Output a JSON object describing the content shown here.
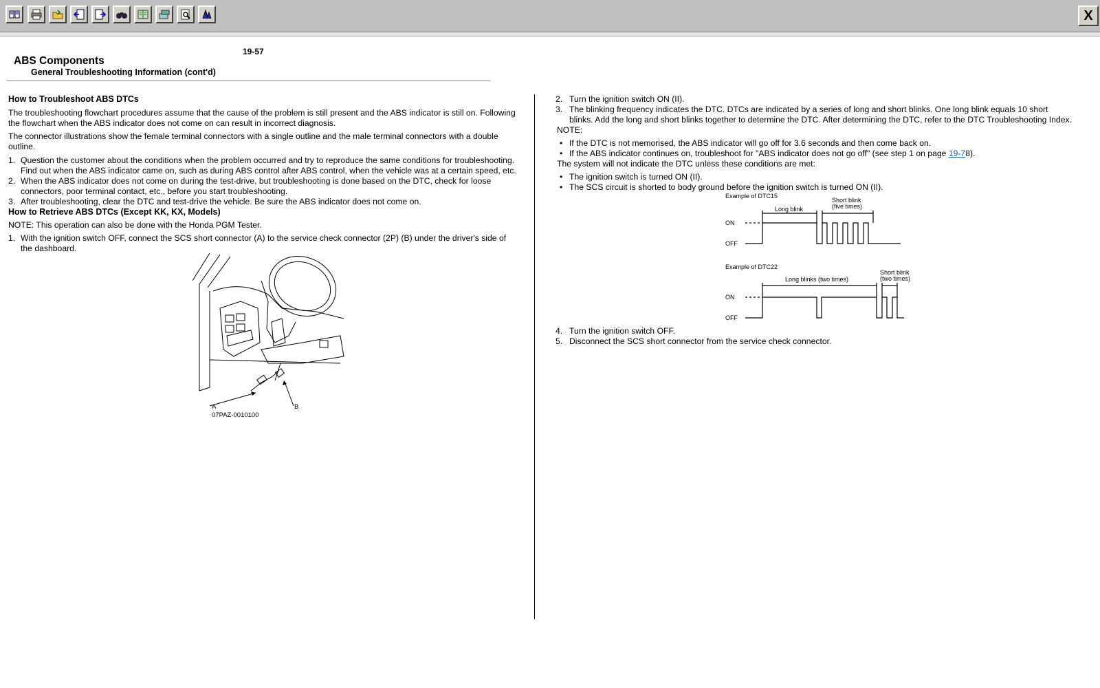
{
  "toolbar": {
    "buttons": [
      {
        "name": "contents-icon"
      },
      {
        "name": "print-icon"
      },
      {
        "name": "open-folder-icon"
      },
      {
        "name": "previous-page-icon"
      },
      {
        "name": "next-page-icon"
      },
      {
        "name": "find-icon"
      },
      {
        "name": "book-icon"
      },
      {
        "name": "sync-icon"
      },
      {
        "name": "preview-icon"
      },
      {
        "name": "bookmark-icon"
      }
    ],
    "close_label": "X"
  },
  "page": {
    "number": "19-57",
    "title": "ABS Components",
    "subtitle": "General Troubleshooting Information (cont'd)"
  },
  "left": {
    "h1": "How to Troubleshoot ABS DTCs",
    "p1_l1": "The troubleshooting flowchart procedures assume that the cause of the problem is still present and the ABS indicator is still on. Following",
    "p1_l2": "the flowchart when the ABS indicator does not come on can result in incorrect diagnosis.",
    "p2_l1": "The connector illustrations show the female terminal connectors with a single outline and the male terminal connectors with a double",
    "p2_l2": "outline.",
    "n1": "1.",
    "s1_l1": "Question the customer about the conditions when the problem occurred and try to reproduce the same conditions for troubleshooting.",
    "s1_l2": "Find out when the ABS indicator came on, such as during ABS control after ABS control, when the vehicle was at a certain speed, etc.",
    "n2": "2.",
    "s2_l1": "When the ABS indicator does not come on during the test-drive, but troubleshooting is done based on the DTC, check for loose",
    "s2_l2": "connectors, poor terminal contact, etc., before you start troubleshooting.",
    "n3": "3.",
    "s3_l1": "After troubleshooting, clear the DTC and test-drive the vehicle. Be sure the ABS indicator does not come on.",
    "h2": "How to Retrieve ABS DTCs (Except KK, KX, Models)",
    "note": "NOTE: This operation can also be done with the Honda PGM Tester.",
    "r1": "1.",
    "r1_l1": "With the ignition switch OFF, connect the SCS short connector (A) to the service check connector (2P) (B) under the driver's side of",
    "r1_l2": "the dashboard.",
    "fig_a": "A",
    "fig_b": "B",
    "fig_code": "07PAZ-0010100"
  },
  "right": {
    "n2": "2.",
    "s2": "Turn the ignition switch ON (II).",
    "n3": "3.",
    "s3_l1": "The blinking frequency indicates the DTC. DTCs are indicated by a series of long and short blinks. One long blink equals 10 short",
    "s3_l2": "blinks. Add the long and short blinks together to determine the DTC. After determining the DTC, refer to the DTC Troubleshooting Index.",
    "note": "NOTE:",
    "b1": "If the DTC is not memorised, the ABS indicator will go off for 3.6 seconds and then come back on.",
    "b2_pre": "If the ABS indicator continues on, troubleshoot for \"ABS indicator does not go off\" (see step 1 on page ",
    "b2_link": "19-7",
    "b2_post": "8).",
    "cond": "The system will not indicate the DTC unless these conditions are met:",
    "b3": "The ignition switch is turned ON (II).",
    "b4": "The SCS circuit is shorted to body ground before the ignition switch is turned ON (II).",
    "dtc15_title": "Example of DTC15",
    "dtc15_long": "Long blink",
    "dtc15_short1": "Short blink",
    "dtc15_short2": "(five times)",
    "on": "ON",
    "off": "OFF",
    "dtc22_title": "Example of DTC22",
    "dtc22_long": "Long blinks (two times)",
    "dtc22_short1": "Short blink",
    "dtc22_short2": "(two times)",
    "n4": "4.",
    "s4": "Turn the ignition switch OFF.",
    "n5": "5.",
    "s5": "Disconnect the SCS short connector from the service check connector."
  }
}
